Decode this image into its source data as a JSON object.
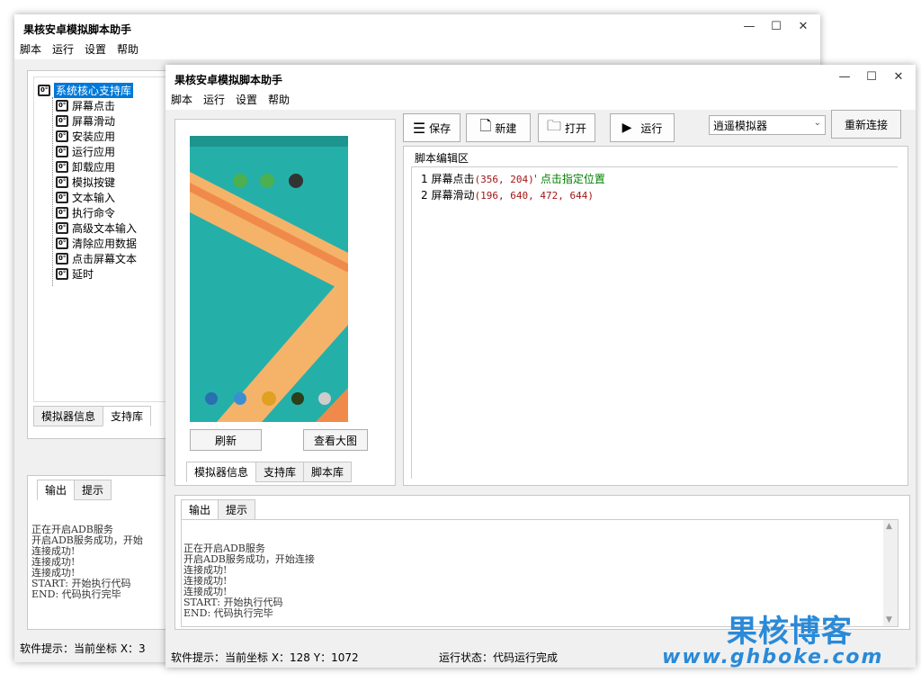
{
  "back_window": {
    "title": "果核安卓模拟脚本助手",
    "menu": [
      "脚本",
      "运行",
      "设置",
      "帮助"
    ],
    "tree_root": "系统核心支持库",
    "tree_items": [
      "屏幕点击",
      "屏幕滑动",
      "安装应用",
      "运行应用",
      "卸载应用",
      "模拟按键",
      "文本输入",
      "执行命令",
      "高级文本输入",
      "清除应用数据",
      "点击屏幕文本",
      "延时"
    ],
    "bottom_tabs": [
      "模拟器信息",
      "支持库"
    ],
    "output_tabs": [
      "输出",
      "提示"
    ],
    "log": [
      "正在开启ADB服务",
      "开启ADB服务成功，开始",
      "连接成功!",
      "连接成功!",
      "连接成功!",
      "START: 开始执行代码",
      "END: 代码执行完毕"
    ],
    "status": "软件提示：当前坐标 X：3"
  },
  "front_window": {
    "title": "果核安卓模拟脚本助手",
    "menu": [
      "脚本",
      "运行",
      "设置",
      "帮助"
    ],
    "toolbar": {
      "save": "保存",
      "new": "新建",
      "open": "打开",
      "run": "运行"
    },
    "emulator_select": "逍遥模拟器",
    "reconnect": "重新连接",
    "refresh": "刷新",
    "view_large": "查看大图",
    "left_tabs": [
      "模拟器信息",
      "支持库",
      "脚本库"
    ],
    "editor_label": "脚本编辑区",
    "script": [
      {
        "num": "1",
        "cmd": "屏幕点击",
        "args": "(356, 204)",
        "comment": "' 点击指定位置"
      },
      {
        "num": "2",
        "cmd": "屏幕滑动",
        "args": "(196, 640, 472, 644)",
        "comment": ""
      }
    ],
    "output_tabs": [
      "输出",
      "提示"
    ],
    "log": [
      "正在开启ADB服务",
      "开启ADB服务成功，开始连接",
      "连接成功!",
      "连接成功!",
      "连接成功!",
      "START: 开始执行代码",
      "END: 代码执行完毕"
    ],
    "status_coord": "软件提示：当前坐标 X：128 Y：1072",
    "status_run": "运行状态：代码运行完成"
  },
  "watermark": {
    "brand": "果核博客",
    "url": "www.ghboke.com"
  },
  "colors": {
    "selected": "#0078d7",
    "watermark": "#2a8ad8",
    "phone_bg": "#24b0a9",
    "phone_stripe": "#f5b36a"
  }
}
